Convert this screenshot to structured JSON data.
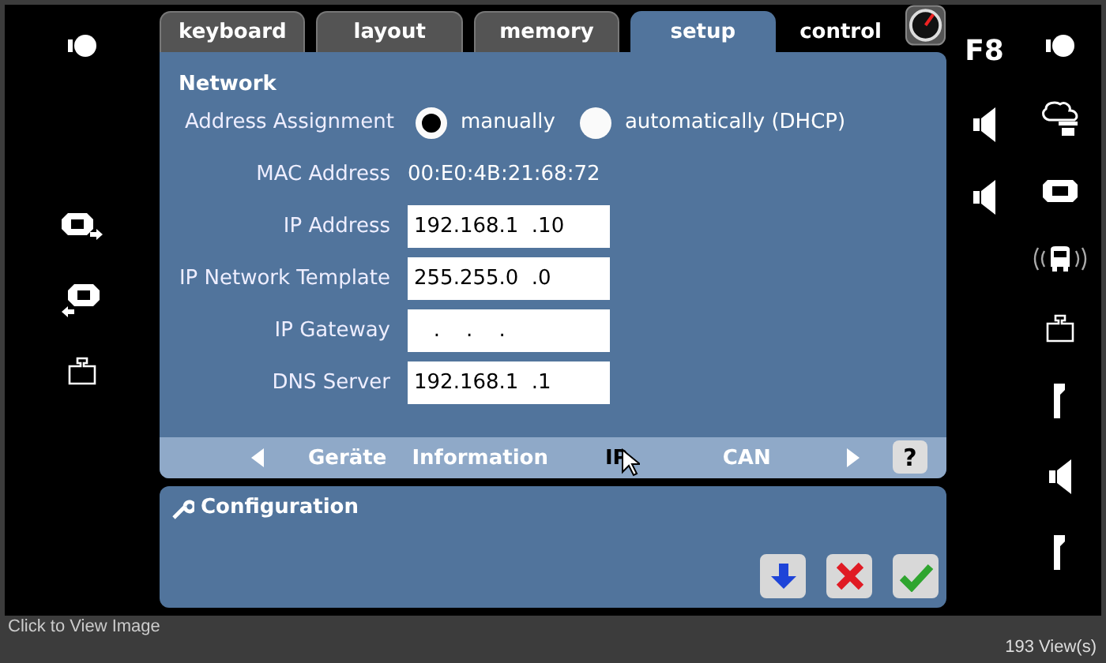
{
  "tabs": [
    {
      "label": "keyboard",
      "kind": "tab",
      "selected": false
    },
    {
      "label": "layout",
      "kind": "tab",
      "selected": false
    },
    {
      "label": "memory",
      "kind": "tab",
      "selected": false
    },
    {
      "label": "setup",
      "kind": "tab",
      "selected": true
    },
    {
      "label": "control",
      "kind": "plain",
      "selected": false
    }
  ],
  "function_key": "F8",
  "network": {
    "title": "Network",
    "assignment_label": "Address Assignment",
    "options": [
      {
        "label": "manually",
        "selected": true
      },
      {
        "label": "automatically (DHCP)",
        "selected": false
      }
    ],
    "fields": [
      {
        "label": "MAC Address",
        "kind": "text",
        "value": "00:E0:4B:21:68:72"
      },
      {
        "label": "IP Address",
        "kind": "input",
        "value": "192.168.1  .10"
      },
      {
        "label": "IP Network Template",
        "kind": "input",
        "value": "255.255.0  .0"
      },
      {
        "label": "IP Gateway",
        "kind": "input",
        "value": "   .    .    ."
      },
      {
        "label": "DNS Server",
        "kind": "input",
        "value": "192.168.1  .1"
      }
    ]
  },
  "subnav": [
    {
      "label": "Geräte",
      "selected": false
    },
    {
      "label": "Information",
      "selected": false
    },
    {
      "label": "IP",
      "selected": true
    },
    {
      "label": "CAN",
      "selected": false
    }
  ],
  "help": "?",
  "configuration": {
    "title": "Configuration"
  },
  "footer": {
    "caption": "Click to View Image",
    "views": "193 View(s)"
  }
}
